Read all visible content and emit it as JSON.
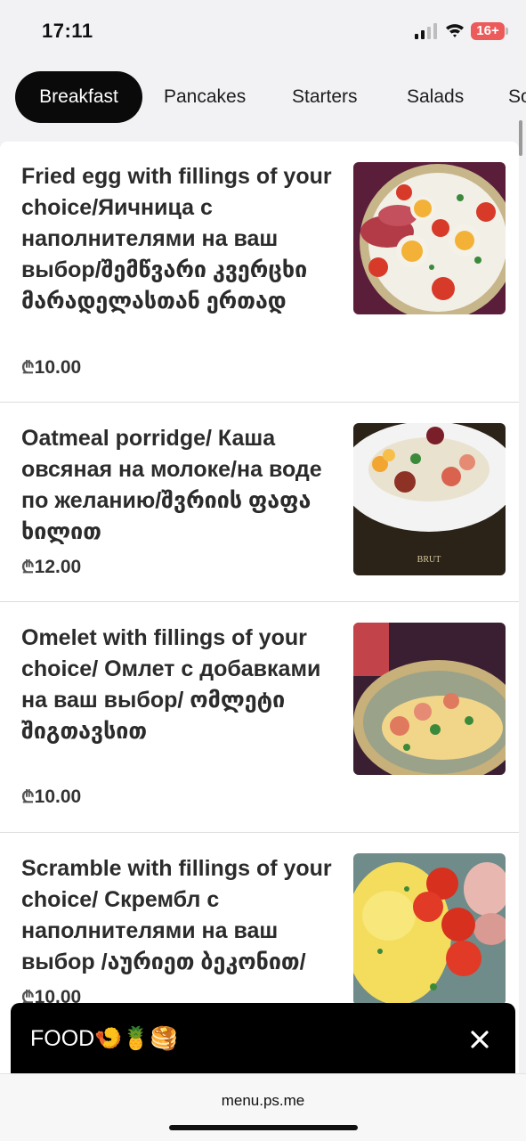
{
  "status_bar": {
    "time": "17:11",
    "battery": "16+"
  },
  "tabs": [
    {
      "label": "Breakfast",
      "active": true
    },
    {
      "label": "Pancakes",
      "active": false
    },
    {
      "label": "Starters",
      "active": false
    },
    {
      "label": "Salads",
      "active": false
    },
    {
      "label": "So",
      "active": false
    }
  ],
  "currency_symbol": "₾",
  "menu_items": [
    {
      "title": "Fried egg with fillings of your choice/Яичница с наполнителями на ваш выбор/შემწვარი კვერცხი მარადელასთან ერთად",
      "price": "10.00",
      "image_icon": "fried-egg-photo"
    },
    {
      "title": "Oatmeal porridge/ Каша овсяная на молоке/на воде по желанию/შვრიის ფაფა ხილით",
      "price": "12.00",
      "image_icon": "oatmeal-photo"
    },
    {
      "title": "Omelet with fillings of your choice/ Омлет с добавками на ваш выбор/ ომლეტი შიგთავსით",
      "price": "10.00",
      "image_icon": "omelet-photo"
    },
    {
      "title": "Scramble with fillings of your choice/ Скрембл с наполнителями на ваш выбор /აურიეთ ბეკონით/",
      "price": "10.00",
      "image_icon": "scramble-photo"
    }
  ],
  "popup": {
    "title": "FOOD🍤🍍🥞",
    "close_icon": "close-icon"
  },
  "browser": {
    "url": "menu.ps.me"
  },
  "colors": {
    "active_tab": "#0a0a0a",
    "popup_bg": "#000000",
    "battery": "#ec5a5a"
  }
}
